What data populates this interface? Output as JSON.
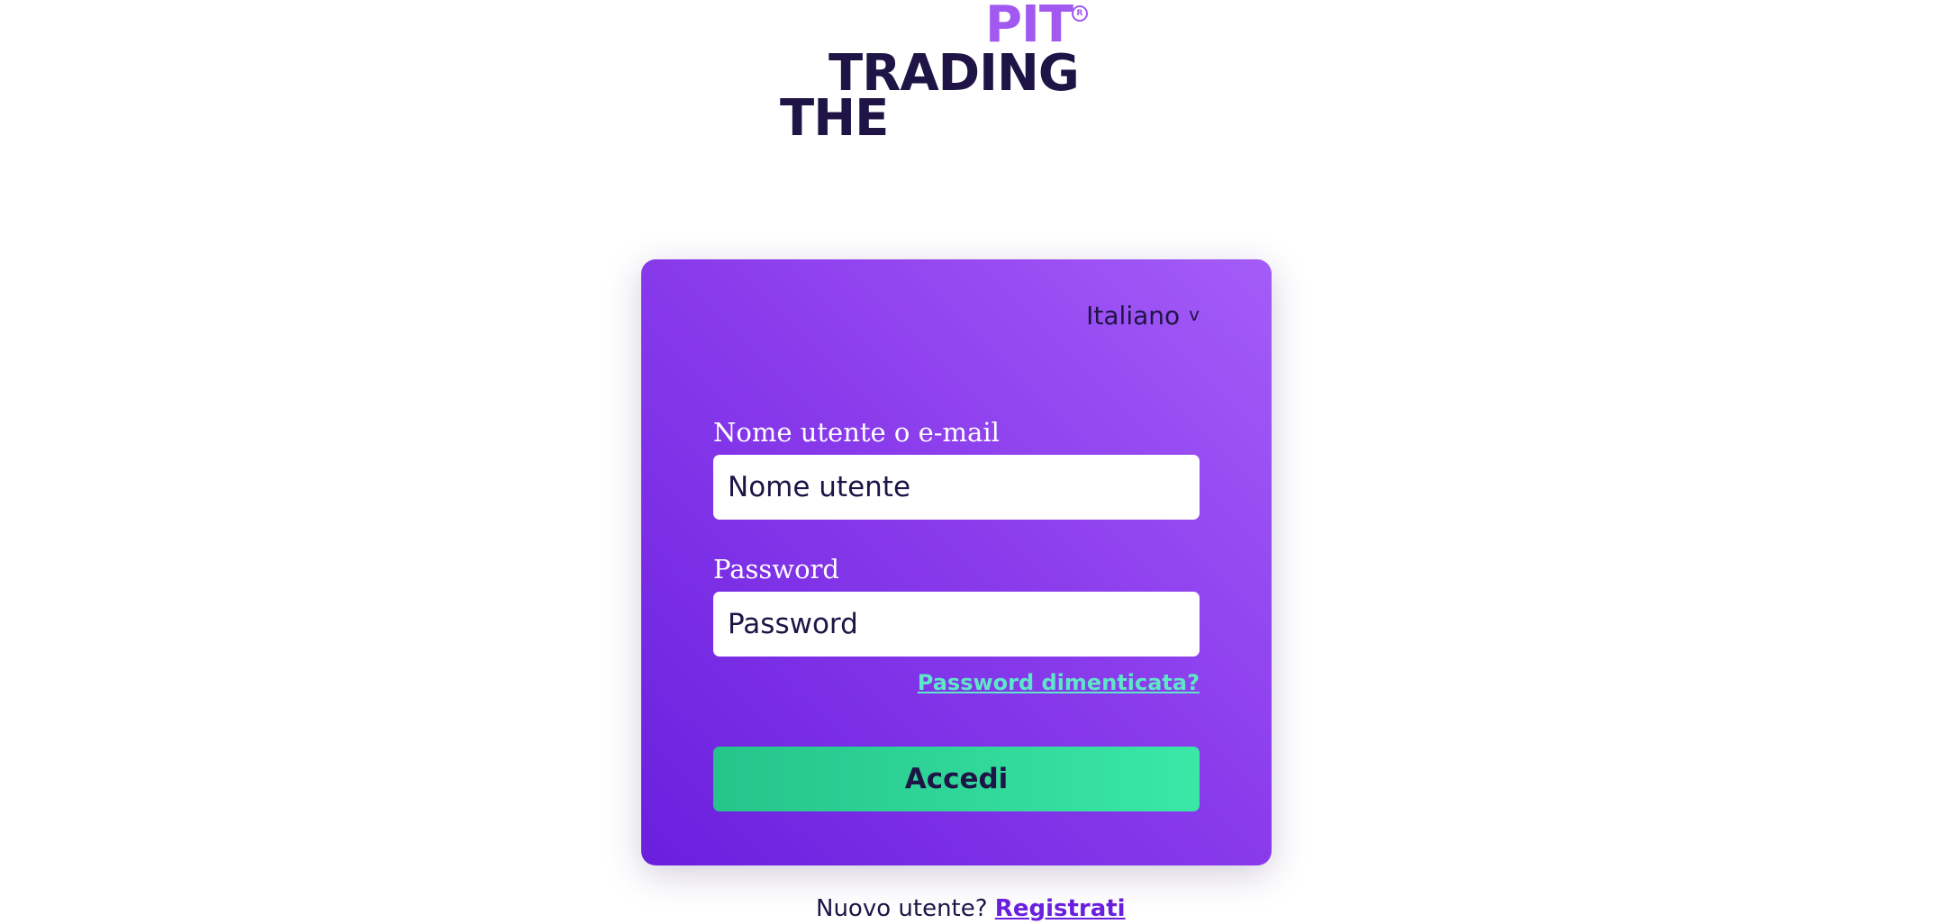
{
  "logo": {
    "line1": "PIT",
    "registered": "R",
    "line2": "TRADING",
    "line3": "THE"
  },
  "colors": {
    "brand_purple": "#a259f0",
    "brand_dark": "#1e1446",
    "card_gradient_start": "#a45cf8",
    "card_gradient_end": "#6a1fde",
    "accent_green": "#3ae8a6",
    "link_teal": "#5ee6c8"
  },
  "login": {
    "language": {
      "selected": "Italiano",
      "chevron": "v",
      "icon": "chevron-down-icon"
    },
    "username": {
      "label": "Nome utente o e-mail",
      "placeholder": "Nome utente",
      "value": ""
    },
    "password": {
      "label": "Password",
      "placeholder": "Password",
      "value": ""
    },
    "forgot_password": "Password dimenticata?",
    "submit": "Accedi"
  },
  "signup": {
    "prompt": "Nuovo utente?",
    "link": "Registrati"
  }
}
